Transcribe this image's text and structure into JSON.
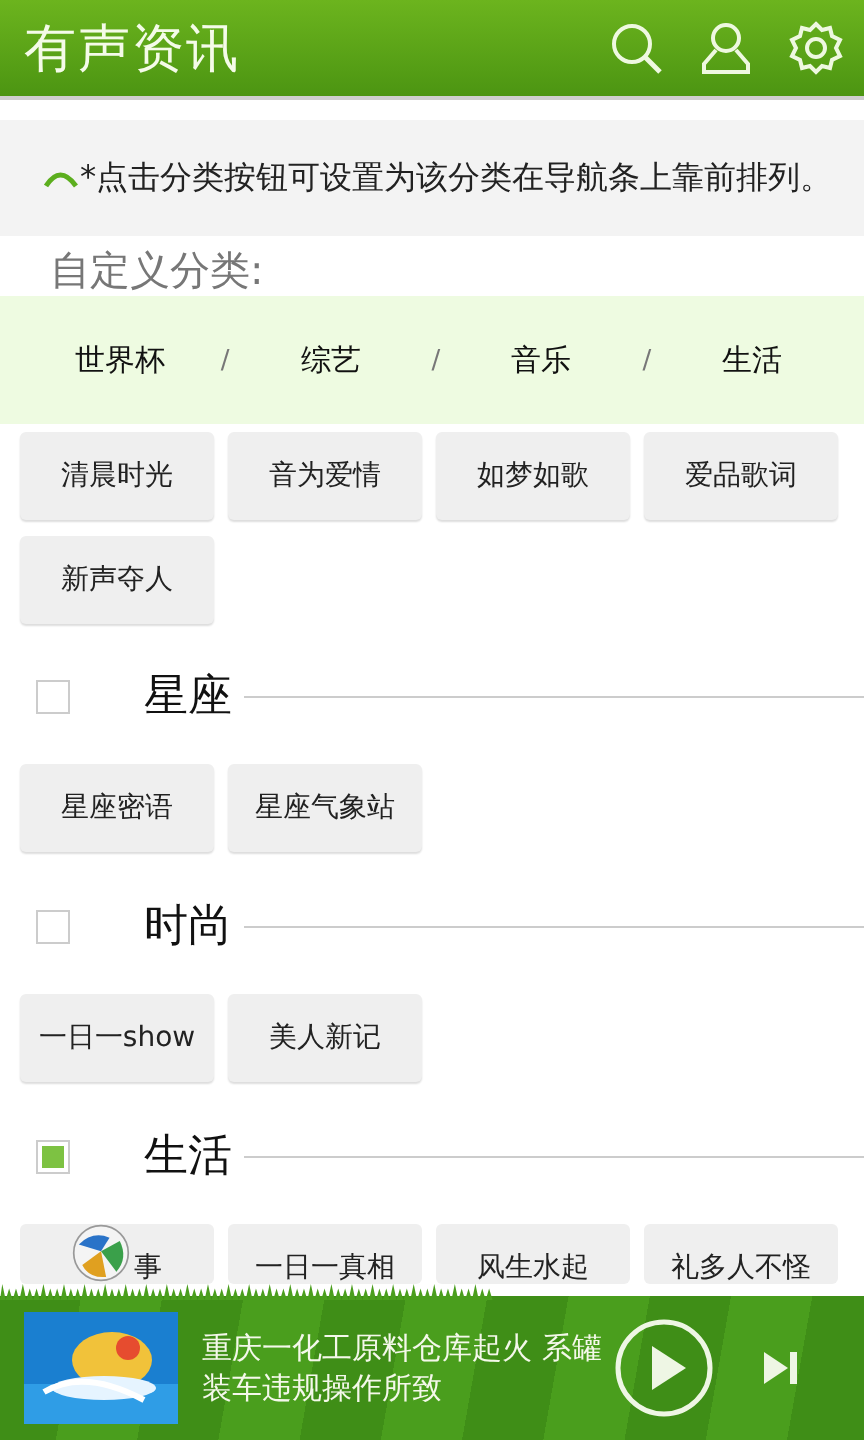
{
  "header": {
    "title": "有声资讯"
  },
  "notice": {
    "text": "*点击分类按钮可设置为该分类在导航条上靠前排列。"
  },
  "custom_label": "自定义分类:",
  "nav_separators": [
    "/",
    "/",
    "/"
  ],
  "nav": [
    {
      "label": "世界杯"
    },
    {
      "label": "综艺"
    },
    {
      "label": "音乐"
    },
    {
      "label": "生活"
    }
  ],
  "top_buttons": [
    "清晨时光",
    "音为爱情",
    "如梦如歌",
    "爱品歌词",
    "新声夺人"
  ],
  "sections": [
    {
      "title": "星座",
      "checked": false,
      "buttons": [
        "星座密语",
        "星座气象站"
      ]
    },
    {
      "title": "时尚",
      "checked": false,
      "buttons": [
        "一日一show",
        "美人新记"
      ]
    },
    {
      "title": "生活",
      "checked": true,
      "buttons": [
        "事",
        "一日一真相",
        "风生水起",
        "礼多人不怪"
      ]
    }
  ],
  "player": {
    "title": "重庆一化工原料仓库起火 系罐装车违规操作所致"
  }
}
